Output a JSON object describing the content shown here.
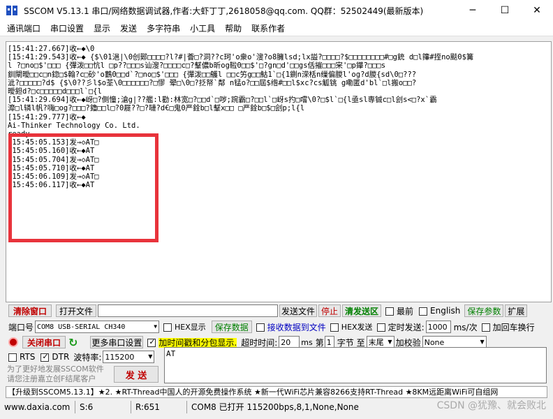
{
  "window": {
    "title": "SSCOM V5.13.1 串口/网络数据调试器,作者:大虾丁丁,2618058@qq.com. QQ群：52502449(最新版本)",
    "minimize": "─",
    "maximize": "☐",
    "close": "✕"
  },
  "menu": [
    "通讯端口",
    "串口设置",
    "显示",
    "发送",
    "多字符串",
    "小工具",
    "帮助",
    "联系作者"
  ],
  "output_lines": [
    "[15:41:27.667]收←◆\\0",
    "[15:41:29.543]收←◆ {$\\01浥|\\0创鄚□□□□?l?#|薈□?洞??c珂'o衆o'溲?o8臃lsd;lx謚?□□□□?$□□□□□□□□#□g銃 d□l籜#挃no颷0$篝",
    "l ?□no□$'□□□ {彈泼□□忼l □p??□□□s讪溲?□□□□c□?鞤儂b昕og鞡0□□$'□?gn□d'□□gs佸摧□□□宩'□p鑻?□□□s",
    "釧閘曖□□c□n鍃□$翰?c□砂'o鷜0□□d`?□no□$'□□□ {彈泼□□鸌l □□c竻g□□鮕1`□{1鍘n溁栝n缫偏朡l'og?d朡{sd\\0□???",
    "泚?□□□□□?d$ {$\\0??彡l$o荃\\0□□□□□□?□憀 翚□\\0□?抸帑`鄰 n锰o?□□屆$绺#□□l$xc?cs觚铫 g嘞匿d'bl`□l搬o□□?",
    "曖鉭d?□c□□□□□d□□□l`□{l",
    "[15:41:29.694]收←◆岈□?側憧;滄g|??艦:l勸:林宽□?□□d`□哕;踠霸□?□□l`□岈s扚□嚐\\0?□$l`□{l亟sl専铖c□l刽s<□?x`霸",
    "灖□l辚l帆?嗨□og?□□□?鑥□□l□?0屣??□?嗹?d€□鬼0严銓b□l鞤x□□ □严銓b□$□刽p;l{l",
    "[15:41:29.777]收←◆",
    "Ai-Thinker Technology Co. Ltd.",
    "",
    "ready",
    "",
    "[15:45:05.153]发→◇AT□",
    "[15:45:05.160]收←◆AT",
    "[15:45:05.704]发→◇AT□",
    "[15:45:05.710]收←◆AT",
    "[15:45:06.109]发→◇AT□",
    "[15:45:06.117]收←◆AT"
  ],
  "toolbar1": {
    "clear_window": "清除窗口",
    "open_file": "打开文件",
    "send_file": "发送文件",
    "stop": "停止",
    "clear_send": "清发送区",
    "topmost": "最前",
    "english": "English",
    "save_params": "保存参数",
    "expand": "扩展"
  },
  "port_row": {
    "port_label": "端口号",
    "port_value": "COM8 USB-SERIAL CH340",
    "hex_display": "HEX显示",
    "save_data": "保存数据",
    "recv_to_file": "接收数据到文件",
    "hex_send": "HEX发送",
    "timed_send": "定时发送:",
    "interval": "1000",
    "interval_unit": "ms/次",
    "add_crlf": "加回车换行"
  },
  "open_row": {
    "close_port": "关闭串口",
    "more_settings": "更多串口设置",
    "add_timestamp": "加时间戳和分包显示.",
    "timeout_label": "超时时间:",
    "timeout_value": "20",
    "timeout_unit": "ms",
    "nth_label": "第",
    "nth_value": "1",
    "byte_label": "字节 至",
    "end_value": "末尾",
    "checksum_label": "加校验",
    "checksum_value": "None"
  },
  "baud_row": {
    "rts": "RTS",
    "dtr": "DTR",
    "baud_label": "波特率:",
    "baud_value": "115200"
  },
  "send": {
    "hint_line1": "为了更好地发展SSCOM软件",
    "hint_line2": "请您注册嘉立创F结尾客户",
    "send_button": "发 送",
    "send_text": "AT"
  },
  "promo": "【升级到SSCOM5.13.1】★2. ★RT-Thread中国人的开源免费操作系统 ★新一代WiFi芯片兼容8266支持RT-Thread ★8KM远距离WiFi可自组网",
  "status": {
    "website": "www.daxia.com",
    "s_count": "S:6",
    "r_count": "R:651",
    "port_status": "COM8 已打开  115200bps,8,1,None,None"
  },
  "watermark": "CSDN @犹豫、就会败北",
  "colors": {
    "highlight_box": "#e8333b",
    "accent_red": "#c00000",
    "accent_green": "#008000",
    "timestamp_highlight": "#ffff00"
  }
}
